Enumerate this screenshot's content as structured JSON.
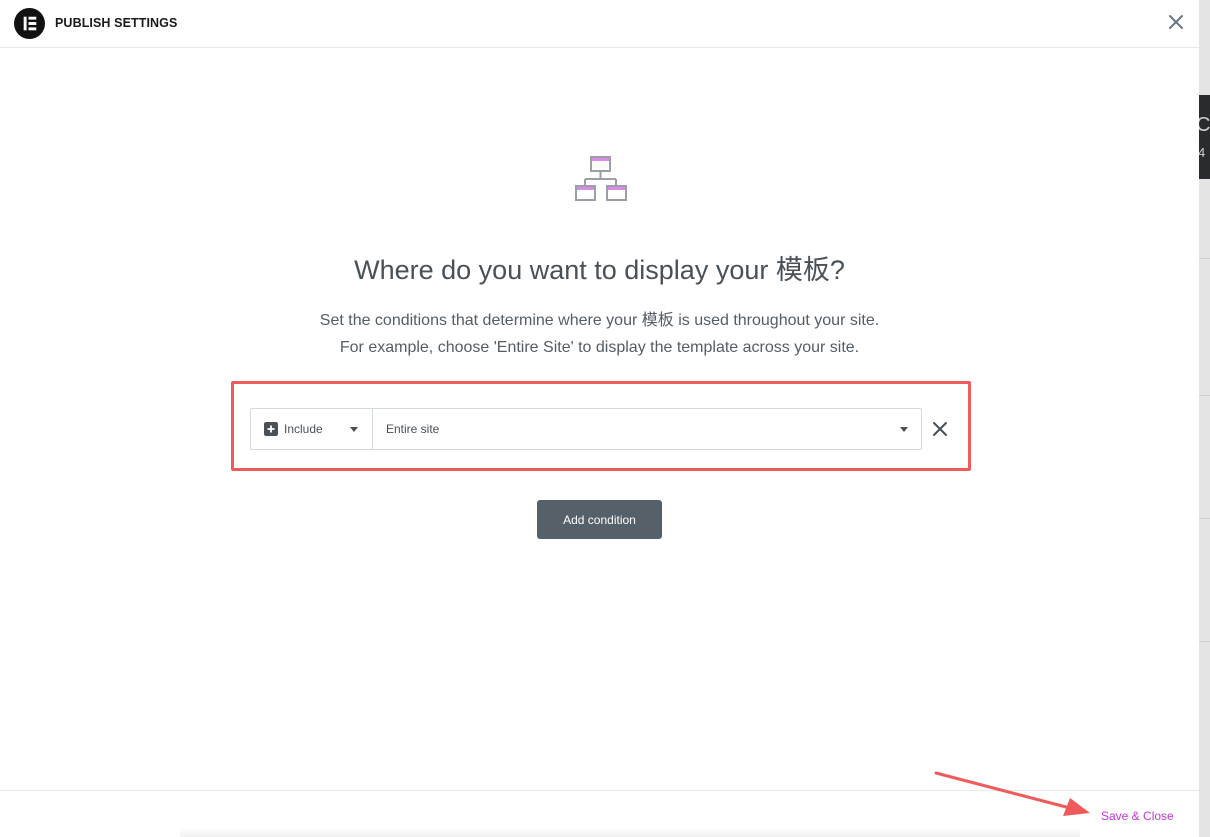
{
  "header": {
    "title": "PUBLISH SETTINGS",
    "logo_icon": "elementor-logo-icon",
    "close_icon": "close-icon"
  },
  "main": {
    "hero_icon": "sitemap-icon",
    "title": "Where do you want to display your 模板?",
    "description_line1": "Set the conditions that determine where your 模板 is used throughout your site.",
    "description_line2": "For example, choose 'Entire Site' to display the template across your site."
  },
  "condition": {
    "type_label": "Include",
    "type_icon": "plus-square-icon",
    "target_label": "Entire site",
    "remove_icon": "close-icon"
  },
  "actions": {
    "add_condition_label": "Add condition",
    "save_close_label": "Save & Close"
  },
  "colors": {
    "accent": "#c036d3",
    "highlight": "#ef5b5b",
    "button_bg": "#556068",
    "text_primary": "#495157"
  }
}
